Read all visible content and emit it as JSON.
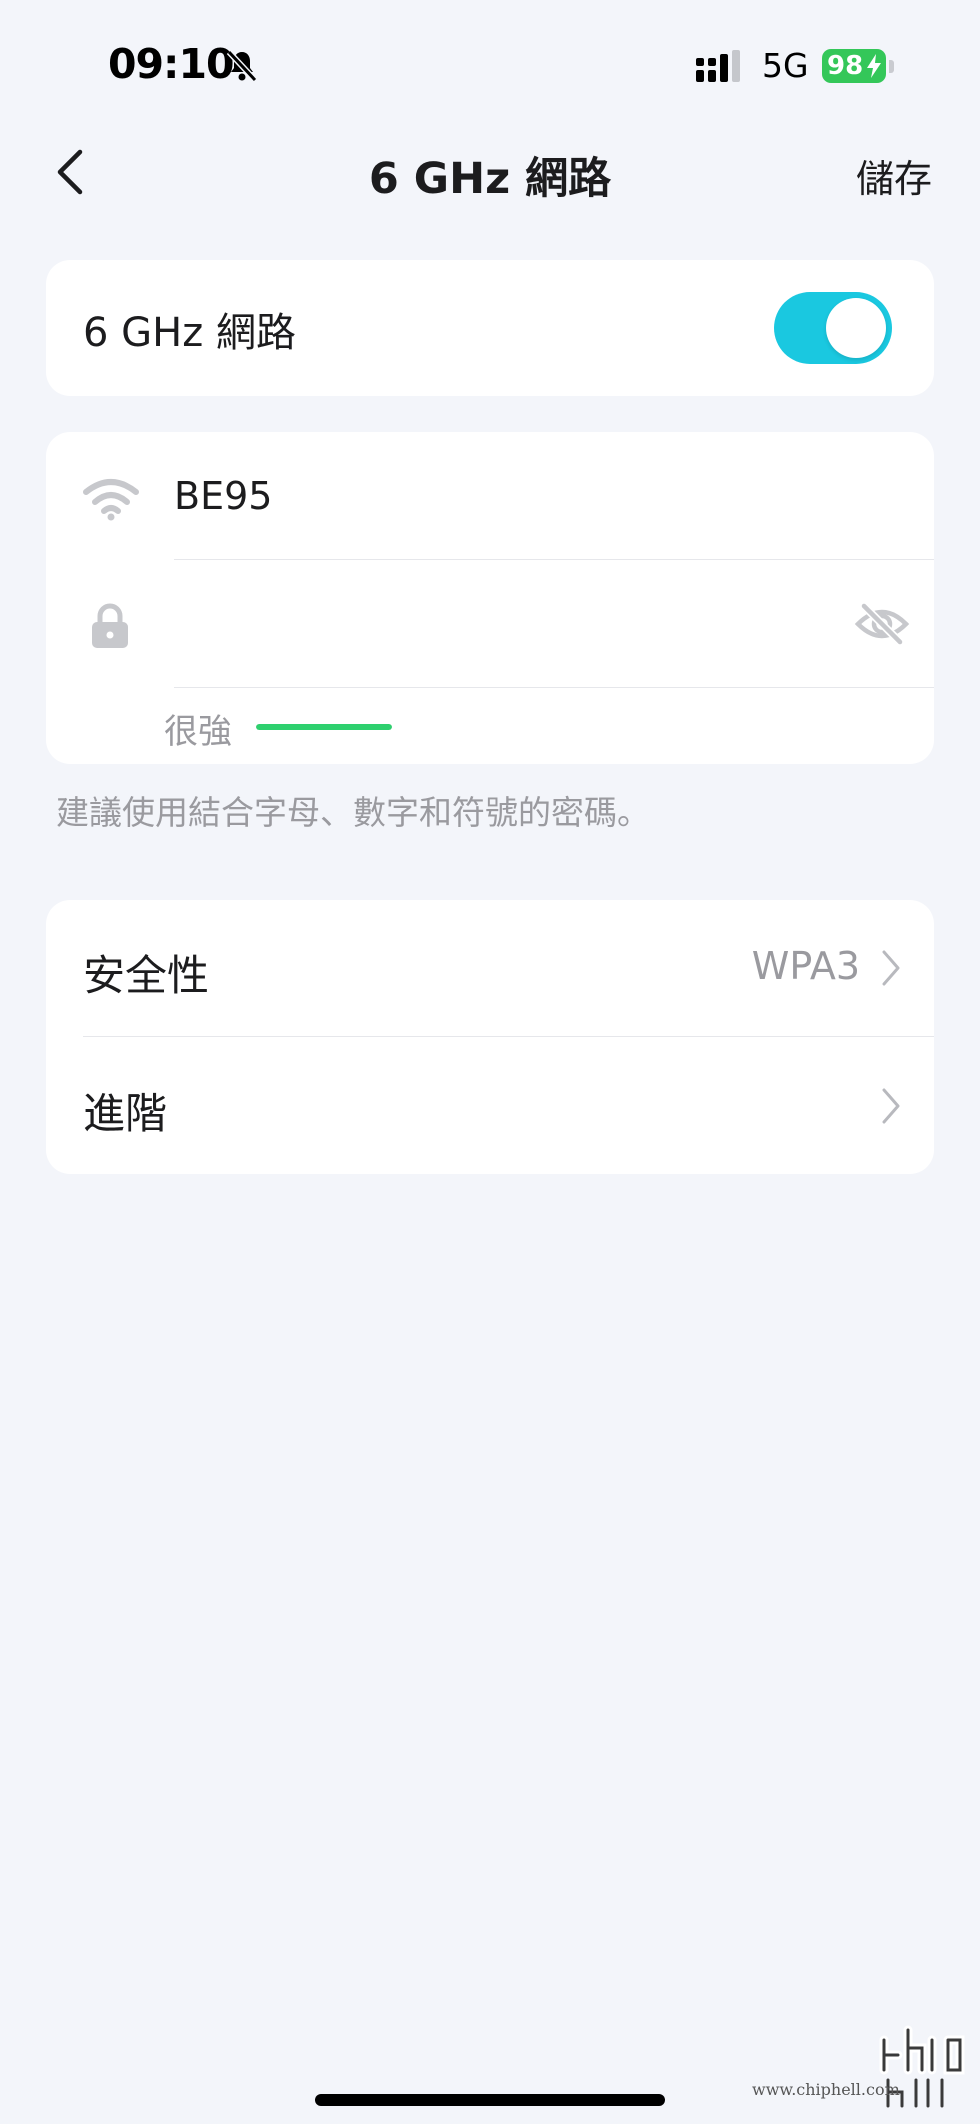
{
  "status_bar": {
    "time": "09:10",
    "network": "5G",
    "battery": "98"
  },
  "nav": {
    "title": "6 GHz 網路",
    "save_label": "儲存"
  },
  "band_toggle": {
    "label": "6 GHz 網路",
    "enabled": true,
    "accent_color": "#1ac8e0"
  },
  "wifi": {
    "ssid": "BE95",
    "password": "",
    "password_visible": false,
    "strength_label": "很強",
    "strength_level": 1.0,
    "strength_color": "#2ed06e"
  },
  "hint": "建議使用結合字母、數字和符號的密碼。",
  "settings": [
    {
      "label": "安全性",
      "value": "WPA3"
    },
    {
      "label": "進階",
      "value": ""
    }
  ],
  "watermark": {
    "url": "www.chiphell.com"
  }
}
